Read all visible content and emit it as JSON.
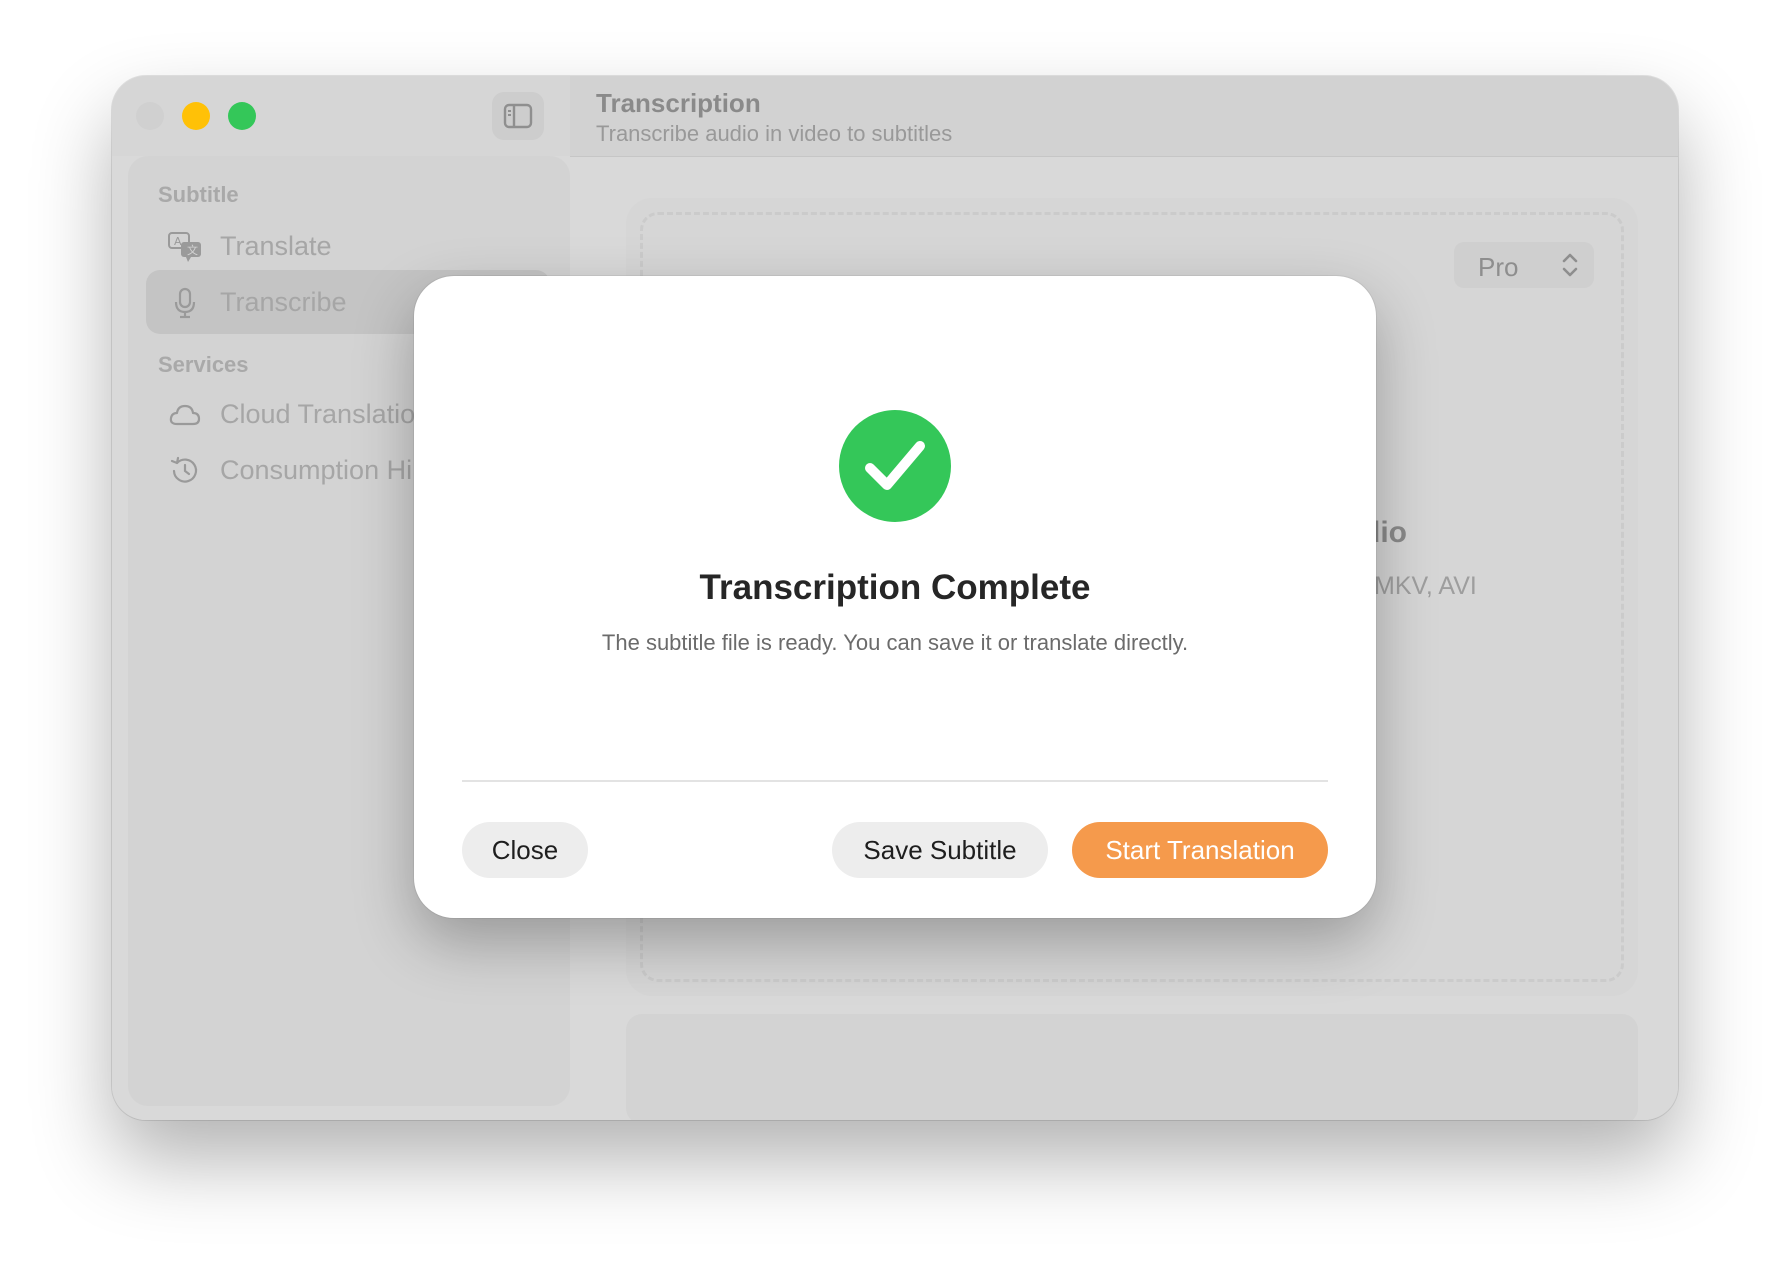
{
  "window": {
    "title": "Transcription",
    "subtitle": "Transcribe audio in video to subtitles"
  },
  "sidebar": {
    "sections": [
      {
        "label": "Subtitle",
        "items": [
          {
            "label": "Translate",
            "icon": "translate-icon",
            "active": false
          },
          {
            "label": "Transcribe",
            "icon": "microphone-icon",
            "active": true
          }
        ]
      },
      {
        "label": "Services",
        "items": [
          {
            "label": "Cloud Translatio",
            "icon": "cloud-icon",
            "active": false
          },
          {
            "label": "Consumption Hi",
            "icon": "history-icon",
            "active": false
          }
        ]
      }
    ]
  },
  "main": {
    "model_select": {
      "value": "Pro"
    },
    "drop_zone": {
      "title_fragment": "dio",
      "formats_fragment": "MKV, AVI"
    }
  },
  "dialog": {
    "icon": "checkmark-circle-icon",
    "title": "Transcription Complete",
    "message": "The subtitle file is ready. You can save it or translate directly.",
    "buttons": {
      "close": "Close",
      "save": "Save Subtitle",
      "translate": "Start Translation"
    }
  },
  "colors": {
    "accent": "#f59a4c",
    "success": "#34c759",
    "traffic_minimize": "#ffc107",
    "traffic_maximize": "#34c759"
  }
}
